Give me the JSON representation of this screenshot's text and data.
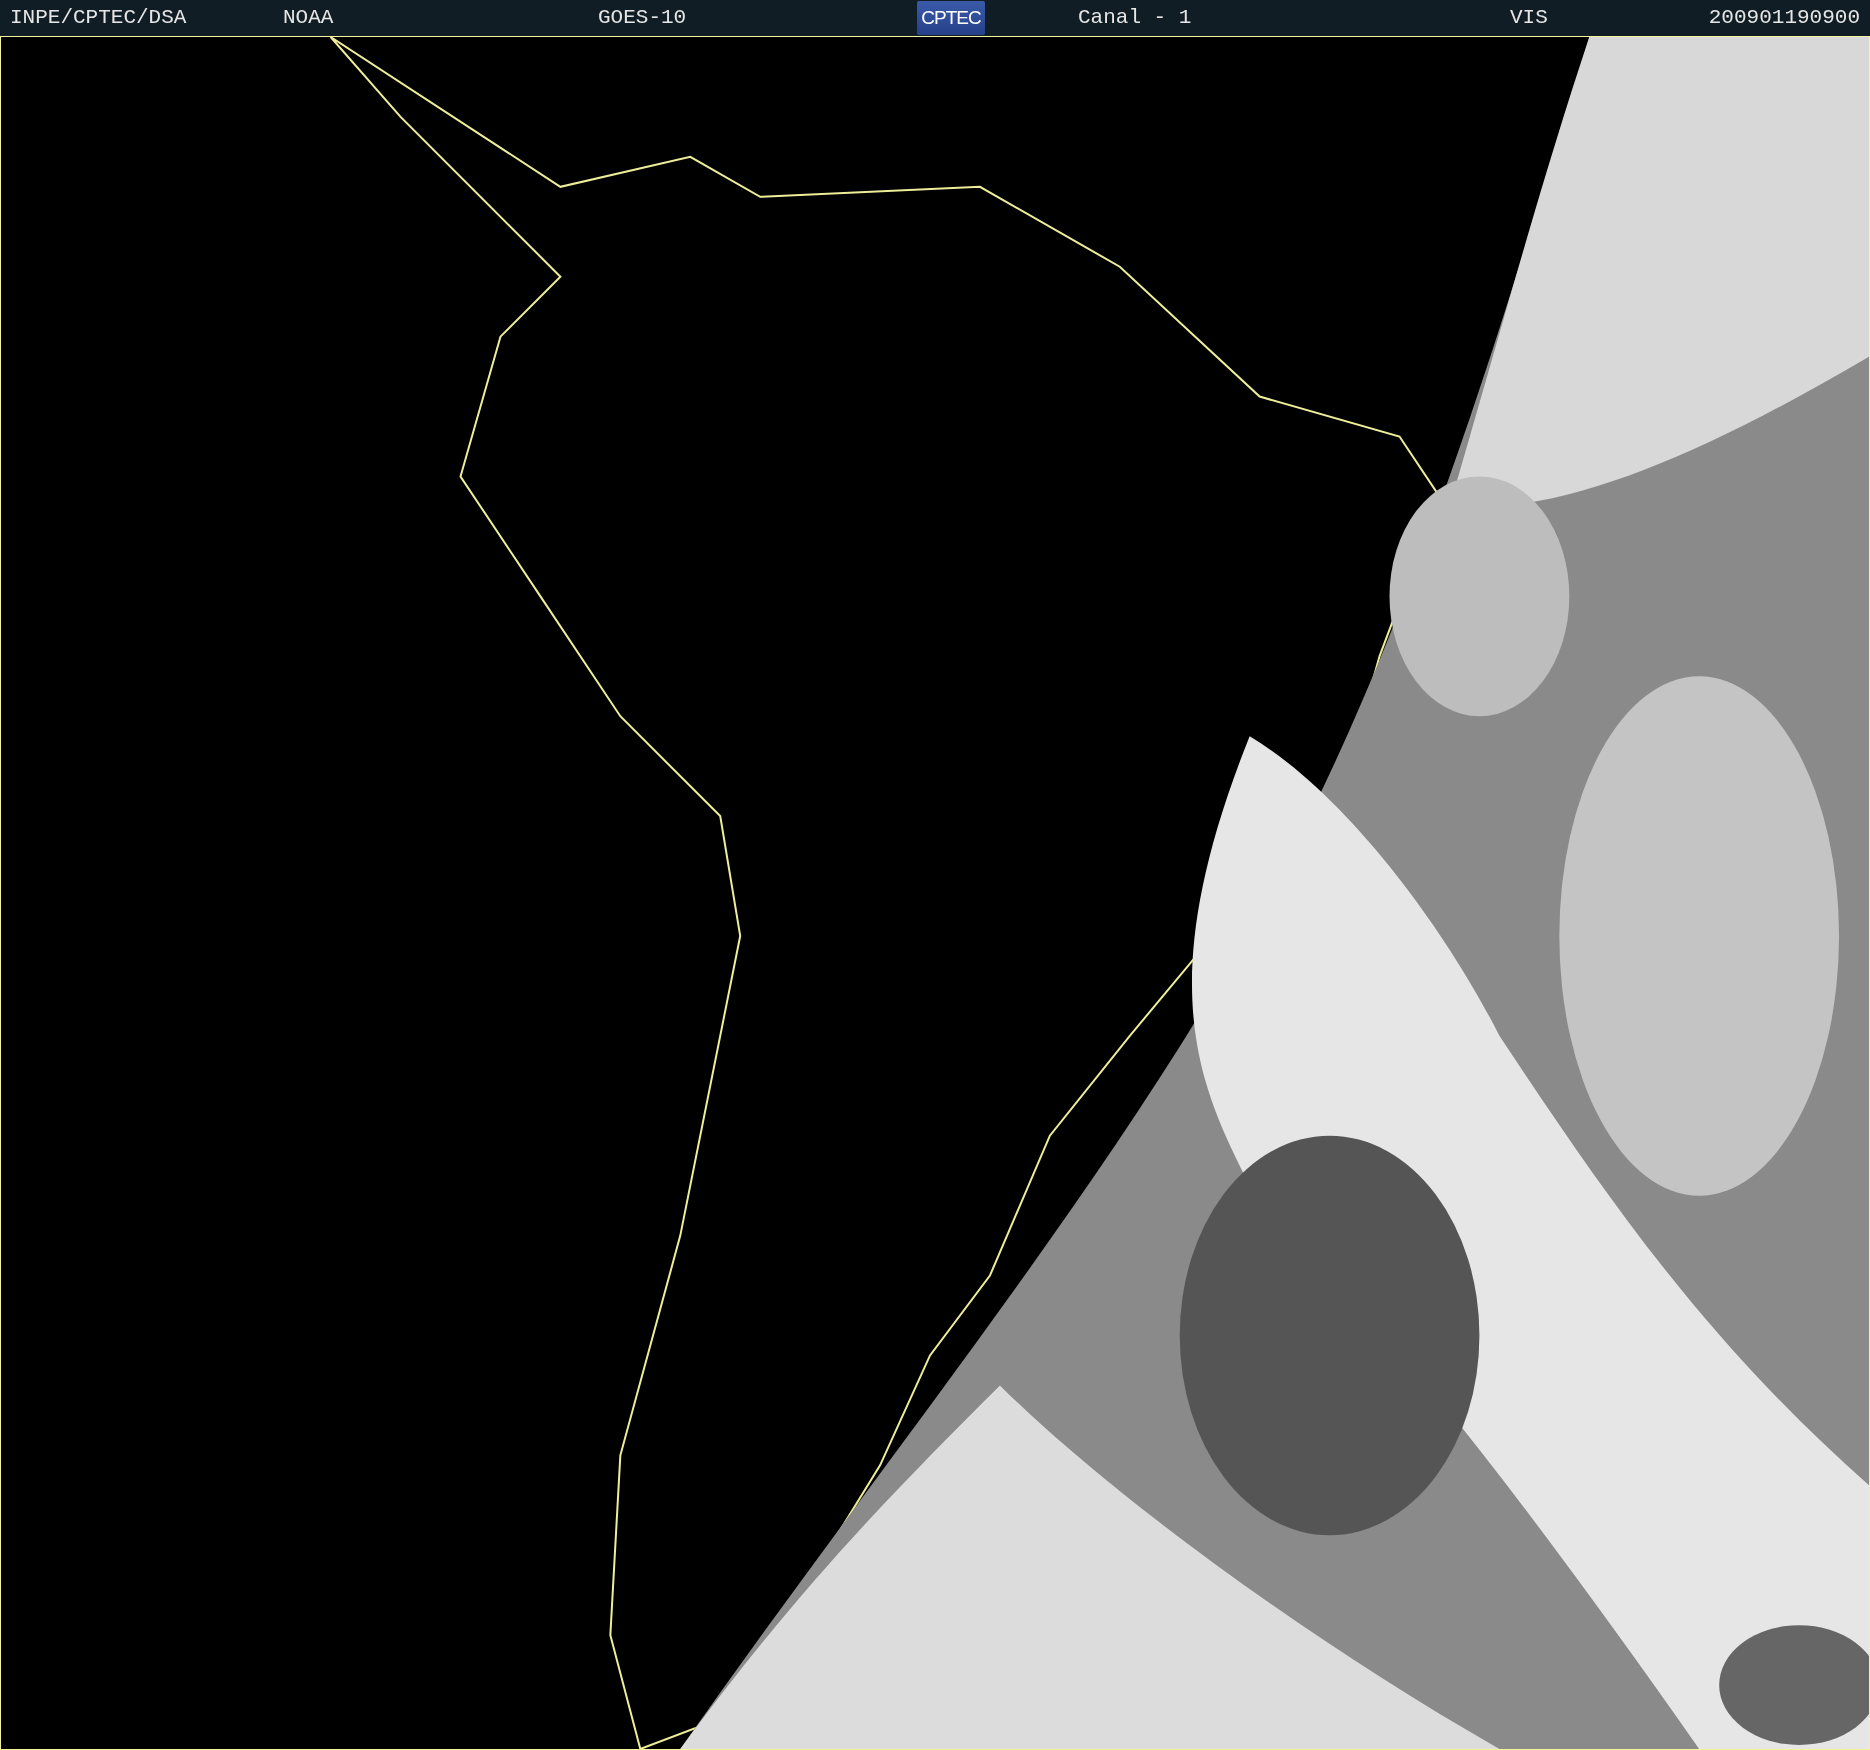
{
  "header": {
    "items": [
      {
        "kind": "text",
        "text": "INPE/CPTEC/DSA"
      },
      {
        "kind": "text",
        "text": "NOAA"
      },
      {
        "kind": "text",
        "text": "GOES-10"
      },
      {
        "kind": "logo",
        "text": "CPTEC"
      },
      {
        "kind": "text",
        "text": "Canal - 1"
      },
      {
        "kind": "text",
        "text": "VIS"
      },
      {
        "kind": "text",
        "text": "200901190900"
      }
    ]
  }
}
